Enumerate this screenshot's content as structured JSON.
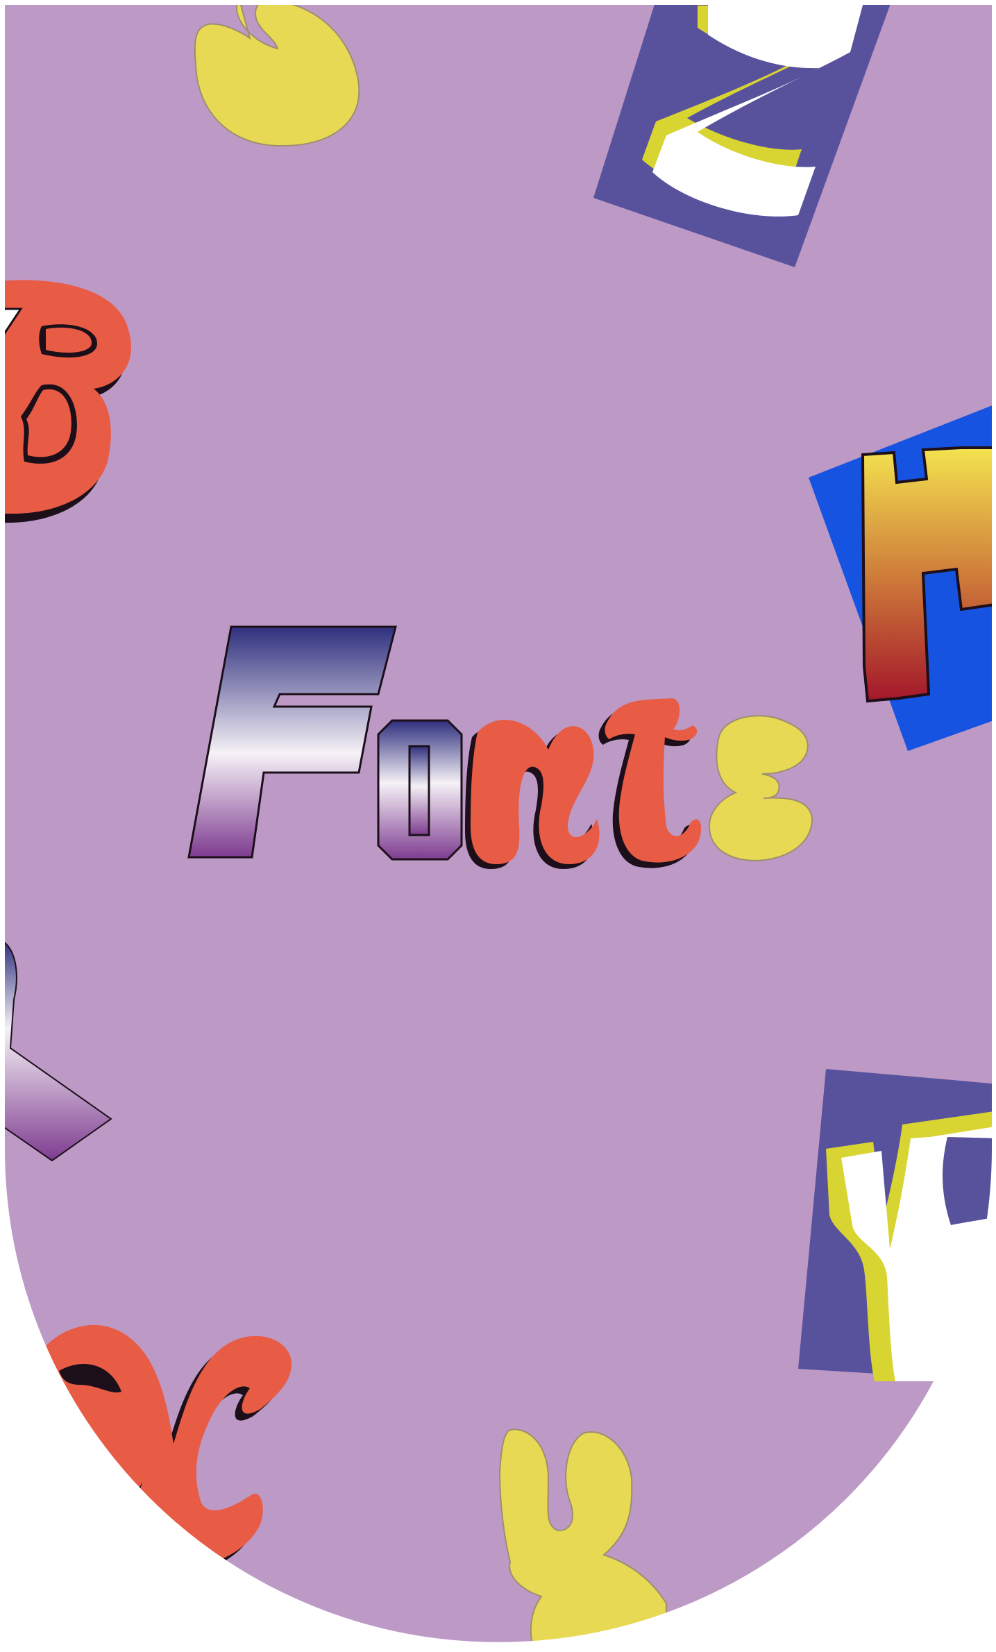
{
  "artwork": {
    "background_color": "#bd99c6",
    "frame_color": "#ffffff",
    "title": {
      "letters": [
        {
          "char": "F",
          "style": "gradient-outline"
        },
        {
          "char": "o",
          "style": "gradient-outline"
        },
        {
          "char": "n",
          "style": "coral-shadow"
        },
        {
          "char": "t",
          "style": "coral-shadow"
        },
        {
          "char": "s",
          "style": "yellow-bubble"
        }
      ]
    },
    "colors": {
      "coral": "#e85b45",
      "shadow": "#1c0f1a",
      "yellow": "#e8d955",
      "indigo_tile": "#58529c",
      "blue_tile": "#1653e0",
      "lime_outline": "#d8d432",
      "gradient_top": "#2f2f7e",
      "gradient_mid": "#f5f1f6",
      "gradient_bottom": "#7e3c90",
      "heat_top": "#f3e34f",
      "heat_bottom": "#a3172a"
    },
    "decorations": [
      {
        "name": "yellow-blob-top",
        "glyph": "yellow bubble letter"
      },
      {
        "name": "tile-z-indigo",
        "glyph": "Z"
      },
      {
        "name": "coral-letter-b",
        "glyph": "B"
      },
      {
        "name": "tile-h-blue",
        "glyph": "H"
      },
      {
        "name": "gradient-letter-k",
        "glyph": "K"
      },
      {
        "name": "tile-k-indigo",
        "glyph": "K"
      },
      {
        "name": "coral-letter-x",
        "glyph": "X"
      },
      {
        "name": "yellow-letter-u",
        "glyph": "yellow bubble letter"
      }
    ]
  }
}
